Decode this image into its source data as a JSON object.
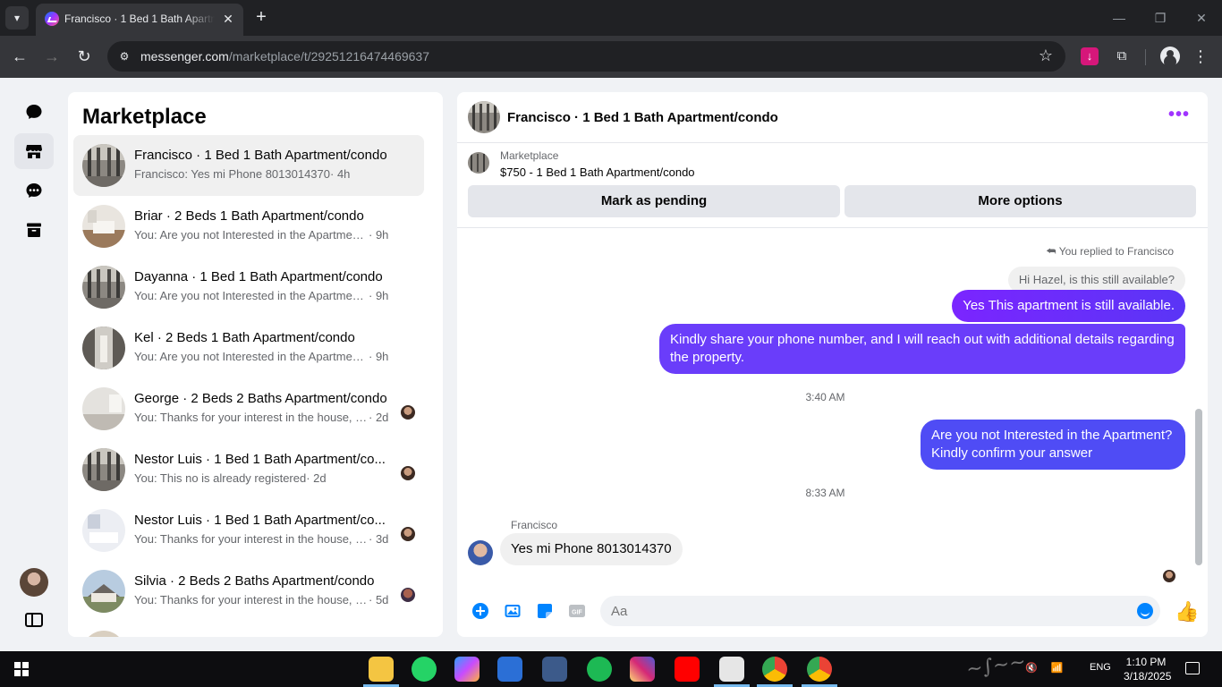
{
  "browser": {
    "tab_title": "Francisco · 1 Bed 1 Bath Apartment/condo",
    "url_host": "messenger.com",
    "url_path": "/marketplace/t/29251216474469637",
    "window_controls": {
      "minimize": "—",
      "maximize": "❐",
      "close": "✕"
    }
  },
  "inbox": {
    "title": "Marketplace",
    "threads": [
      {
        "name": "Francisco · 1 Bed 1 Bath Apartment/condo",
        "snippet": "Francisco: Yes mi Phone 8013014370",
        "time": " · 4h",
        "active": true
      },
      {
        "name": "Briar · 2 Beds 1 Bath Apartment/condo",
        "snippet": "You: Are you not Interested in the Apartment...",
        "time": " · 9h"
      },
      {
        "name": "Dayanna · 1 Bed 1 Bath Apartment/condo",
        "snippet": "You: Are you not Interested in the Apartment...",
        "time": " · 9h"
      },
      {
        "name": "Kel · 2 Beds 1 Bath Apartment/condo",
        "snippet": "You: Are you not Interested in the Apartment...",
        "time": " · 9h"
      },
      {
        "name": "George · 2 Beds 2 Baths Apartment/condo",
        "snippet": "You: Thanks for your interest in the house, w...",
        "time": " · 2d"
      },
      {
        "name": "Nestor Luis · 1 Bed 1 Bath Apartment/co...",
        "snippet": "You: This no is already registered",
        "time": " · 2d"
      },
      {
        "name": "Nestor Luis · 1 Bed 1 Bath Apartment/co...",
        "snippet": "You: Thanks for your interest in the house, w...",
        "time": " · 3d"
      },
      {
        "name": "Silvia · 2 Beds 2 Baths Apartment/condo",
        "snippet": "You: Thanks for your interest in the house, w...",
        "time": " · 5d"
      }
    ]
  },
  "conversation": {
    "title": "Francisco · 1 Bed 1 Bath Apartment/condo",
    "listing_label": "Marketplace",
    "listing_price": "$750 - 1 Bed 1 Bath Apartment/condo",
    "mark_pending": "Mark as pending",
    "more_options": "More options",
    "replied_note": "You replied to Francisco",
    "quoted": "Hi Hazel, is this still available?",
    "msg1": "Yes This apartment is still available.",
    "msg2": "Kindly share your phone number, and I will reach out with additional details regarding the property.",
    "time1": "3:40 AM",
    "msg3": "Are you not Interested in the Apartment? Kindly confirm your answer",
    "time2": "8:33 AM",
    "sender": "Francisco",
    "reply": "Yes mi Phone 8013014370",
    "composer_placeholder": "Aa"
  },
  "taskbar": {
    "lang": "ENG",
    "time": "1:10 PM",
    "date": "3/18/2025"
  },
  "colors": {
    "brand": "#0084ff",
    "outgoing": "#6a3dfa",
    "tab_bg": "#35363a"
  }
}
